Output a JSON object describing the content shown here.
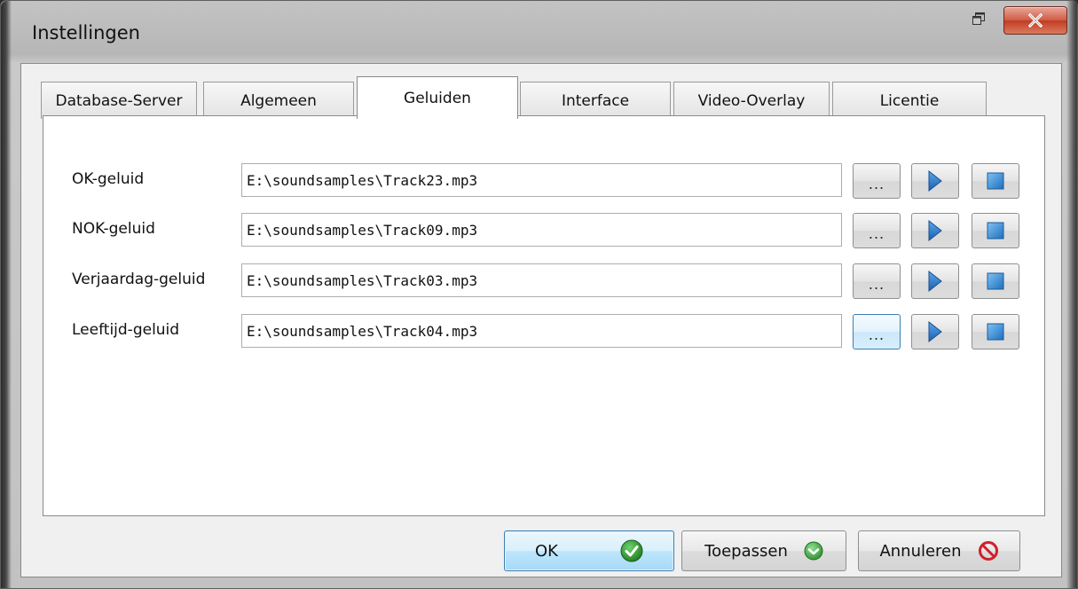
{
  "window": {
    "title": "Instellingen"
  },
  "tabs": [
    {
      "label": "Database-Server",
      "active": false
    },
    {
      "label": "Algemeen",
      "active": false
    },
    {
      "label": "Geluiden",
      "active": true
    },
    {
      "label": "Interface",
      "active": false
    },
    {
      "label": "Video-Overlay",
      "active": false
    },
    {
      "label": "Licentie",
      "active": false
    }
  ],
  "sounds": [
    {
      "label": "OK-geluid",
      "path": "E:\\soundsamples\\Track23.mp3"
    },
    {
      "label": "NOK-geluid",
      "path": "E:\\soundsamples\\Track09.mp3"
    },
    {
      "label": "Verjaardag-geluid",
      "path": "E:\\soundsamples\\Track03.mp3"
    },
    {
      "label": "Leeftijd-geluid",
      "path": "E:\\soundsamples\\Track04.mp3"
    }
  ],
  "row_buttons": {
    "browse_label": "...",
    "browse_icon": "ellipsis-icon",
    "play_icon": "play-icon",
    "stop_icon": "stop-icon"
  },
  "footer": {
    "ok_label": "OK",
    "apply_label": "Toepassen",
    "cancel_label": "Annuleren"
  },
  "colors": {
    "accent_blue": "#3c7fb1",
    "play_blue": "#2a6fc0",
    "ok_green": "#2e8b2e",
    "cancel_red": "#d0202a"
  }
}
